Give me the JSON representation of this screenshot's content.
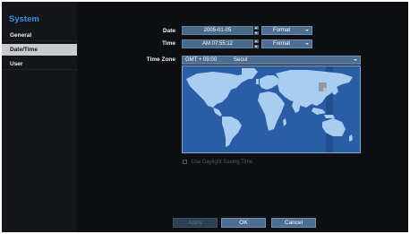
{
  "sidebar": {
    "title": "System",
    "items": [
      {
        "label": "General",
        "active": false
      },
      {
        "label": "Date/Time",
        "active": true
      },
      {
        "label": "User",
        "active": false
      }
    ]
  },
  "date": {
    "label": "Date",
    "value": "2005-01-05",
    "format_label": "Format"
  },
  "time": {
    "label": "Time",
    "value": "AM 07:55:12",
    "format_label": "Format"
  },
  "timezone": {
    "label": "Time Zone",
    "offset": "GMT + 09:00",
    "city": "Seoul"
  },
  "dst": {
    "label": "Use Daylight Saving Time",
    "checked": false,
    "enabled": false
  },
  "buttons": {
    "apply": "Apply",
    "ok": "OK",
    "cancel": "Cancel"
  },
  "colors": {
    "accent": "#3e8fe0",
    "field": "#4a6a89",
    "ocean": "#2a5da6",
    "land": "#a9cdf0"
  }
}
